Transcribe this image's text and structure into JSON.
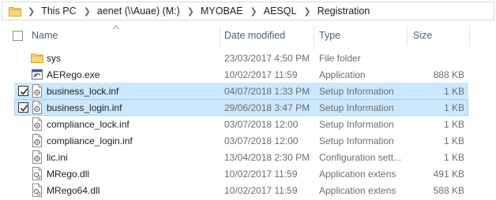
{
  "breadcrumb": [
    "This PC",
    "aenet (\\\\Auae) (M:)",
    "MYOBAE",
    "AESQL",
    "Registration"
  ],
  "columns": {
    "name": "Name",
    "date_modified": "Date modified",
    "type": "Type",
    "size": "Size",
    "sort_column": "name",
    "sort_direction": "ascending"
  },
  "files": [
    {
      "name": "sys",
      "date": "23/03/2017 4:50 PM",
      "type": "File folder",
      "size": "",
      "icon": "folder-icon",
      "state": "normal"
    },
    {
      "name": "AERego.exe",
      "date": "10/02/2017 11:59",
      "type": "Application",
      "size": "888 KB",
      "icon": "application-icon",
      "state": "normal"
    },
    {
      "name": "business_lock.inf",
      "date": "04/07/2018 1:33 PM",
      "type": "Setup Information",
      "size": "1 KB",
      "icon": "setup-info-icon",
      "state": "selected"
    },
    {
      "name": "business_login.inf",
      "date": "29/06/2018 3:47 PM",
      "type": "Setup Information",
      "size": "1 KB",
      "icon": "setup-info-icon",
      "state": "focused"
    },
    {
      "name": "compliance_lock.inf",
      "date": "03/07/2018 12:00",
      "type": "Setup Information",
      "size": "1 KB",
      "icon": "setup-info-icon",
      "state": "normal"
    },
    {
      "name": "compliance_login.inf",
      "date": "03/07/2018 12:00",
      "type": "Setup Information",
      "size": "1 KB",
      "icon": "setup-info-icon",
      "state": "normal"
    },
    {
      "name": "lic.ini",
      "date": "13/04/2018 2:30 PM",
      "type": "Configuration sett...",
      "size": "1 KB",
      "icon": "config-settings-icon",
      "state": "normal"
    },
    {
      "name": "MRego.dll",
      "date": "10/02/2017 11:59",
      "type": "Application extens",
      "size": "491 KB",
      "icon": "dll-icon",
      "state": "normal"
    },
    {
      "name": "MRego64.dll",
      "date": "10/02/2017 11:59",
      "type": "Application extens",
      "size": "588 KB",
      "icon": "dll-icon",
      "state": "normal"
    }
  ],
  "colors": {
    "selection": "#cce8ff",
    "focus_border": "#99d1ff",
    "header_text": "#4d6082",
    "folder": "#f8d775"
  }
}
